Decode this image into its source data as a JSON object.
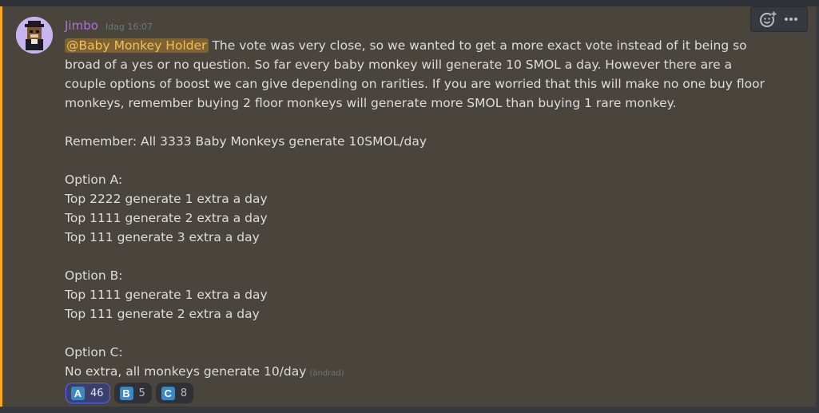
{
  "message": {
    "username": "Jimbo",
    "timestamp": "Idag 16:07",
    "mention": "@Baby Monkey Holder",
    "paragraph1": " The vote was very close, so we wanted to get a more exact vote instead of it being so broad of a yes or no question. So far every baby monkey will generate 10 SMOL a day. However there are a couple options of boost we can give depending on rarities. If you are worried that this will make no one buy floor monkeys, remember buying 2 floor monkeys will generate more SMOL than buying 1 rare monkey.",
    "reminder": "Remember: All 3333 Baby Monkeys generate 10SMOL/day",
    "option_a": {
      "title": "Option A:",
      "lines": [
        "Top 2222 generate 1 extra a day",
        "Top 1111 generate 2 extra a day",
        "Top 111 generate 3 extra a day"
      ]
    },
    "option_b": {
      "title": "Option B:",
      "lines": [
        "Top 1111 generate 1 extra a day",
        "Top 111 generate 2 extra a day"
      ]
    },
    "option_c": {
      "title": "Option C:",
      "line": "No extra, all monkeys generate 10/day",
      "edited": "(ändrad)"
    }
  },
  "reactions": [
    {
      "letter": "A",
      "count": "46",
      "active": true,
      "icon": "regional-indicator-a"
    },
    {
      "letter": "B",
      "count": "5",
      "active": false,
      "icon": "regional-indicator-b"
    },
    {
      "letter": "C",
      "count": "8",
      "active": false,
      "icon": "regional-indicator-c"
    }
  ],
  "toolbar": {
    "icons": [
      "add-reaction-icon",
      "more-options-icon"
    ]
  },
  "colors": {
    "accent_bar": "#faa81a",
    "message_highlight": "#49443c",
    "username": "#b06ee0",
    "mention_bg": "#5a4a2a",
    "reaction_active_border": "#5865f2"
  }
}
